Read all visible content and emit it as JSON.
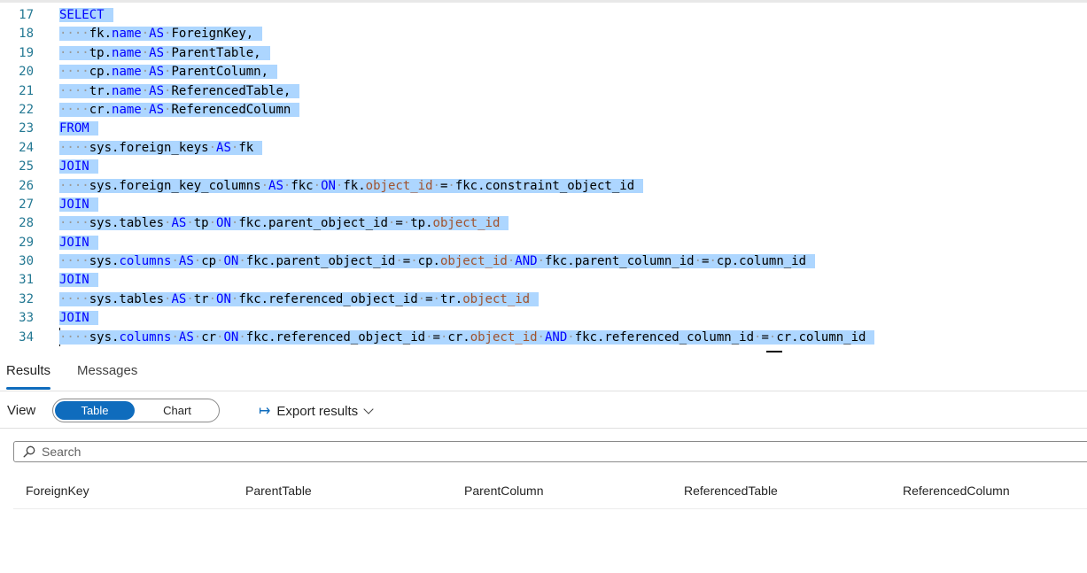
{
  "editor": {
    "lines": [
      {
        "n": "17",
        "parts": [
          [
            "kw",
            "SELECT"
          ]
        ]
      },
      {
        "n": "18",
        "parts": [
          [
            "ws",
            "····"
          ],
          [
            "t",
            "fk."
          ],
          [
            "kw",
            "name"
          ],
          [
            "ws",
            "·"
          ],
          [
            "kw",
            "AS"
          ],
          [
            "ws",
            "·"
          ],
          [
            "t",
            "ForeignKey,"
          ]
        ]
      },
      {
        "n": "19",
        "parts": [
          [
            "ws",
            "····"
          ],
          [
            "t",
            "tp."
          ],
          [
            "kw",
            "name"
          ],
          [
            "ws",
            "·"
          ],
          [
            "kw",
            "AS"
          ],
          [
            "ws",
            "·"
          ],
          [
            "t",
            "ParentTable,"
          ]
        ]
      },
      {
        "n": "20",
        "parts": [
          [
            "ws",
            "····"
          ],
          [
            "t",
            "cp."
          ],
          [
            "kw",
            "name"
          ],
          [
            "ws",
            "·"
          ],
          [
            "kw",
            "AS"
          ],
          [
            "ws",
            "·"
          ],
          [
            "t",
            "ParentColumn,"
          ]
        ]
      },
      {
        "n": "21",
        "parts": [
          [
            "ws",
            "····"
          ],
          [
            "t",
            "tr."
          ],
          [
            "kw",
            "name"
          ],
          [
            "ws",
            "·"
          ],
          [
            "kw",
            "AS"
          ],
          [
            "ws",
            "·"
          ],
          [
            "t",
            "ReferencedTable,"
          ]
        ]
      },
      {
        "n": "22",
        "parts": [
          [
            "ws",
            "····"
          ],
          [
            "t",
            "cr."
          ],
          [
            "kw",
            "name"
          ],
          [
            "ws",
            "·"
          ],
          [
            "kw",
            "AS"
          ],
          [
            "ws",
            "·"
          ],
          [
            "t",
            "ReferencedColumn"
          ]
        ]
      },
      {
        "n": "23",
        "parts": [
          [
            "kw",
            "FROM"
          ]
        ]
      },
      {
        "n": "24",
        "parts": [
          [
            "ws",
            "····"
          ],
          [
            "t",
            "sys.foreign_keys"
          ],
          [
            "ws",
            "·"
          ],
          [
            "kw",
            "AS"
          ],
          [
            "ws",
            "·"
          ],
          [
            "t",
            "fk"
          ]
        ]
      },
      {
        "n": "25",
        "parts": [
          [
            "kw",
            "JOIN"
          ]
        ]
      },
      {
        "n": "26",
        "parts": [
          [
            "ws",
            "····"
          ],
          [
            "t",
            "sys.foreign_key_columns"
          ],
          [
            "ws",
            "·"
          ],
          [
            "kw",
            "AS"
          ],
          [
            "ws",
            "·"
          ],
          [
            "t",
            "fkc"
          ],
          [
            "ws",
            "·"
          ],
          [
            "kw",
            "ON"
          ],
          [
            "ws",
            "·"
          ],
          [
            "t",
            "fk."
          ],
          [
            "fn",
            "object_id"
          ],
          [
            "ws",
            "·"
          ],
          [
            "t",
            "="
          ],
          [
            "ws",
            "·"
          ],
          [
            "t",
            "fkc.constraint_object_id"
          ]
        ]
      },
      {
        "n": "27",
        "parts": [
          [
            "kw",
            "JOIN"
          ]
        ]
      },
      {
        "n": "28",
        "parts": [
          [
            "ws",
            "····"
          ],
          [
            "t",
            "sys.tables"
          ],
          [
            "ws",
            "·"
          ],
          [
            "kw",
            "AS"
          ],
          [
            "ws",
            "·"
          ],
          [
            "t",
            "tp"
          ],
          [
            "ws",
            "·"
          ],
          [
            "kw",
            "ON"
          ],
          [
            "ws",
            "·"
          ],
          [
            "t",
            "fkc.parent_object_id"
          ],
          [
            "ws",
            "·"
          ],
          [
            "t",
            "="
          ],
          [
            "ws",
            "·"
          ],
          [
            "t",
            "tp."
          ],
          [
            "fn",
            "object_id"
          ]
        ]
      },
      {
        "n": "29",
        "parts": [
          [
            "kw",
            "JOIN"
          ]
        ]
      },
      {
        "n": "30",
        "parts": [
          [
            "ws",
            "····"
          ],
          [
            "t",
            "sys."
          ],
          [
            "kw",
            "columns"
          ],
          [
            "ws",
            "·"
          ],
          [
            "kw",
            "AS"
          ],
          [
            "ws",
            "·"
          ],
          [
            "t",
            "cp"
          ],
          [
            "ws",
            "·"
          ],
          [
            "kw",
            "ON"
          ],
          [
            "ws",
            "·"
          ],
          [
            "t",
            "fkc.parent_object_id"
          ],
          [
            "ws",
            "·"
          ],
          [
            "t",
            "="
          ],
          [
            "ws",
            "·"
          ],
          [
            "t",
            "cp."
          ],
          [
            "fn",
            "object_id"
          ],
          [
            "ws",
            "·"
          ],
          [
            "kw",
            "AND"
          ],
          [
            "ws",
            "·"
          ],
          [
            "t",
            "fkc.parent_column_id"
          ],
          [
            "ws",
            "·"
          ],
          [
            "t",
            "="
          ],
          [
            "ws",
            "·"
          ],
          [
            "t",
            "cp.column_id"
          ]
        ]
      },
      {
        "n": "31",
        "parts": [
          [
            "kw",
            "JOIN"
          ]
        ]
      },
      {
        "n": "32",
        "parts": [
          [
            "ws",
            "····"
          ],
          [
            "t",
            "sys.tables"
          ],
          [
            "ws",
            "·"
          ],
          [
            "kw",
            "AS"
          ],
          [
            "ws",
            "·"
          ],
          [
            "t",
            "tr"
          ],
          [
            "ws",
            "·"
          ],
          [
            "kw",
            "ON"
          ],
          [
            "ws",
            "·"
          ],
          [
            "t",
            "fkc.referenced_object_id"
          ],
          [
            "ws",
            "·"
          ],
          [
            "t",
            "="
          ],
          [
            "ws",
            "·"
          ],
          [
            "t",
            "tr."
          ],
          [
            "fn",
            "object_id"
          ]
        ]
      },
      {
        "n": "33",
        "parts": [
          [
            "kw",
            "JOIN"
          ]
        ]
      },
      {
        "n": "34",
        "parts": [
          [
            "ws",
            "····"
          ],
          [
            "t",
            "sys."
          ],
          [
            "kw",
            "columns"
          ],
          [
            "ws",
            "·"
          ],
          [
            "kw",
            "AS"
          ],
          [
            "ws",
            "·"
          ],
          [
            "t",
            "cr"
          ],
          [
            "ws",
            "·"
          ],
          [
            "kw",
            "ON"
          ],
          [
            "ws",
            "·"
          ],
          [
            "t",
            "fkc.referenced_object_id"
          ],
          [
            "ws",
            "·"
          ],
          [
            "t",
            "="
          ],
          [
            "ws",
            "·"
          ],
          [
            "t",
            "cr."
          ],
          [
            "fn",
            "object_id"
          ],
          [
            "ws",
            "·"
          ],
          [
            "kw",
            "AND"
          ],
          [
            "ws",
            "·"
          ],
          [
            "t",
            "fkc.referenced_column_id"
          ],
          [
            "ws",
            "·"
          ],
          [
            "t",
            "="
          ],
          [
            "ws",
            "·"
          ],
          [
            "t",
            "cr.column_id"
          ]
        ]
      }
    ]
  },
  "tabs": {
    "results": "Results",
    "messages": "Messages"
  },
  "toolbar": {
    "view_label": "View",
    "table_label": "Table",
    "chart_label": "Chart",
    "export_label": "Export results"
  },
  "search": {
    "placeholder": "Search"
  },
  "columns": [
    "ForeignKey",
    "ParentTable",
    "ParentColumn",
    "ReferencedTable",
    "ReferencedColumn"
  ],
  "colors": {
    "selection": "#add6ff",
    "keyword": "#0000ff",
    "function": "#a0522d",
    "accent": "#0f6cbd"
  }
}
